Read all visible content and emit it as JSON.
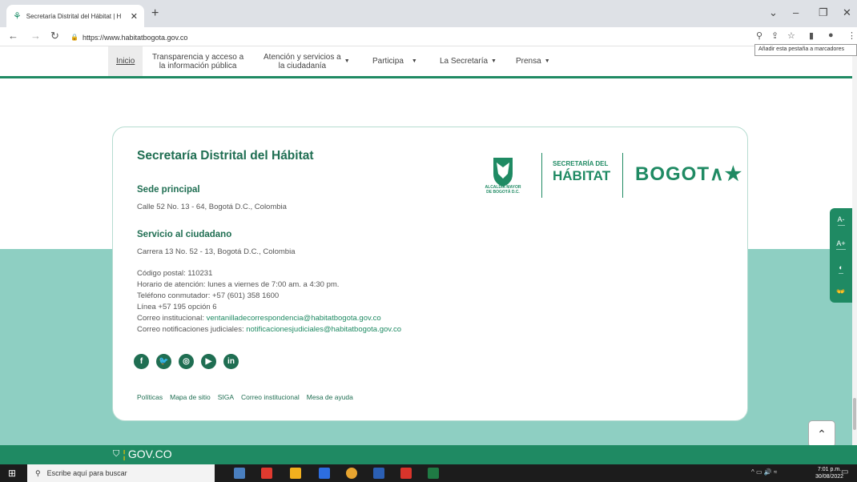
{
  "browser": {
    "tab_title": "Secretaría Distrital del Hábitat | H",
    "tab_close": "✕",
    "new_tab": "+",
    "url": "https://www.habitatbogota.gov.co",
    "tooltip": "Añadir esta pestaña a marcadores"
  },
  "nav": {
    "items": [
      {
        "label": "Inicio"
      },
      {
        "label": "Transparencia y acceso a",
        "label2": "la información pública"
      },
      {
        "label": "Atención y servicios a",
        "label2": "la ciudadanía"
      },
      {
        "label": "Participa"
      },
      {
        "label": "La Secretaría"
      },
      {
        "label": "Prensa"
      }
    ]
  },
  "card": {
    "title": "Secretaría Distrital del Hábitat",
    "sede_heading": "Sede principal",
    "sede_address": "Calle 52 No. 13 - 64, Bogotá D.C., Colombia",
    "servicio_heading": "Servicio al ciudadano",
    "servicio_address": "Carrera 13 No. 52 - 13, Bogotá D.C., Colombia",
    "codigo_postal": "Código postal: 110231",
    "horario": "Horario de atención: lunes a viernes de 7:00 am. a 4:30 pm.",
    "telefono": "Teléfono conmutador: +57 (601) 358 1600",
    "linea": "Línea +57 195 opción 6",
    "correo_label": "Correo institucional: ",
    "correo_link": "ventanilladecorrespondencia@habitatbogota.gov.co",
    "notif_label": "Correo notificaciones judiciales: ",
    "notif_link": "notificacionesjudiciales@habitatbogota.gov.co",
    "social_icons": [
      "facebook-icon",
      "twitter-icon",
      "instagram-icon",
      "youtube-icon",
      "linkedin-icon"
    ],
    "footer_links": [
      "Políticas",
      "Mapa de sitio",
      "SIGA",
      "Correo institucional",
      "Mesa de ayuda"
    ]
  },
  "logos": {
    "alcaldia_line1": "ALCALDÍA MAYOR",
    "alcaldia_line2": "DE BOGOTÁ D.C.",
    "secretaria_line1": "SECRETARÍA DEL",
    "secretaria_line2": "HÁBITAT",
    "bogota": "BOGOT"
  },
  "a11y": {
    "decrease": "A-",
    "increase": "A+",
    "contrast": "◐",
    "sign": "👐"
  },
  "gov": {
    "label": "GOV.CO"
  },
  "taskbar": {
    "search_placeholder": "Escribe aquí para buscar",
    "time": "7:01 p.m.",
    "date": "30/08/2022"
  },
  "colors": {
    "brand_green": "#1f8a63",
    "teal_band": "#8ecfc2",
    "heading_green": "#1f6e52"
  }
}
